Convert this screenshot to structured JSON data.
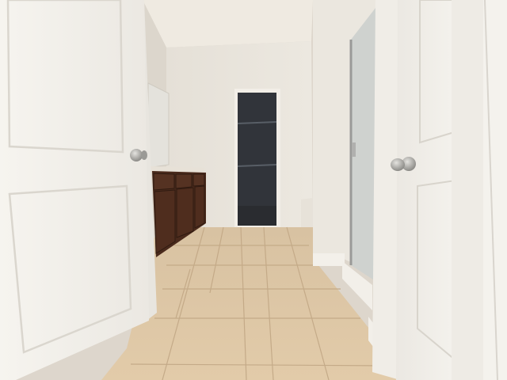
{
  "scene": {
    "description_free": true,
    "colors": {
      "wall": "#e9e4dc",
      "wall_shadow": "#d8d2c8",
      "ceiling": "#f0ebe2",
      "tile": "#ddc5a3",
      "tile_grout": "#c2a886",
      "door": "#f3f1ec",
      "door_panel_edge": "#dcd8d0",
      "cabinet": "#4a2a1c",
      "cabinet_dark": "#3a1f14",
      "countertop": "#e6e0d6",
      "closet_dark": "#2e3137",
      "closet_shelf": "#545a62",
      "glass": "#c9ccc9",
      "metal": "#9a9a98",
      "knob": "#a8a7a3"
    },
    "icons": [
      "door-knob-icon"
    ]
  }
}
